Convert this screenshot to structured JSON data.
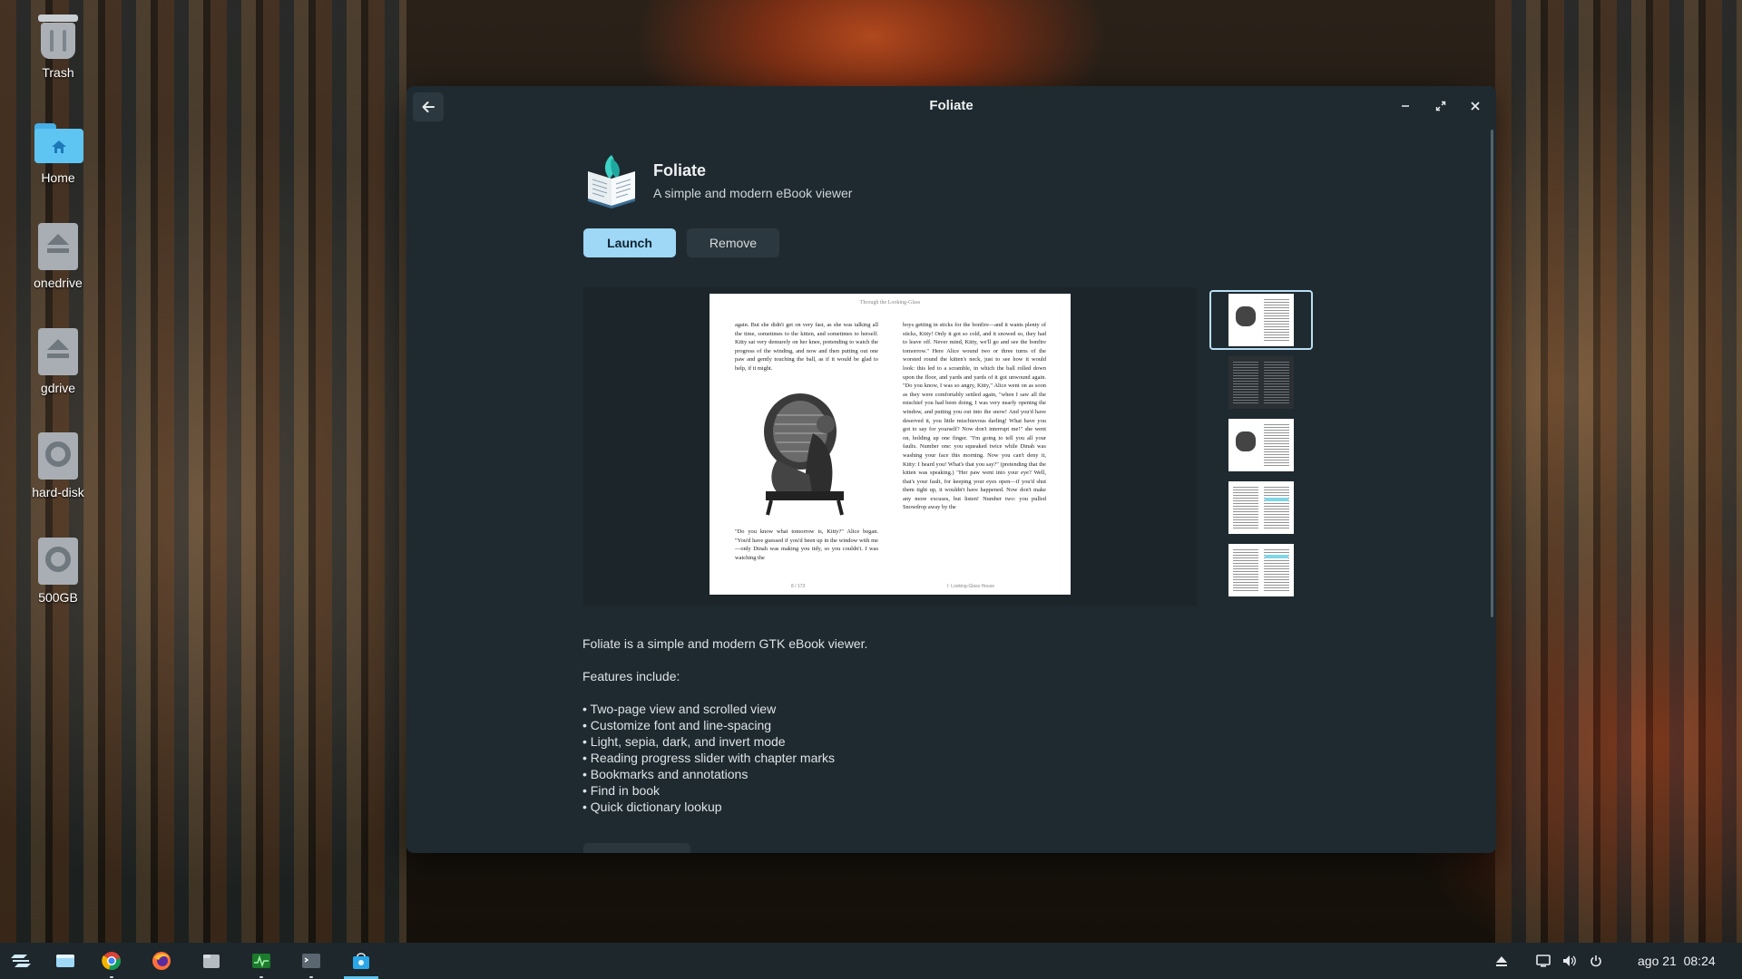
{
  "desktop": {
    "icons": [
      {
        "label": "Trash",
        "icon": "trash-icon"
      },
      {
        "label": "Home",
        "icon": "home-folder-icon"
      },
      {
        "label": "onedrive",
        "icon": "drive-eject-icon"
      },
      {
        "label": "gdrive",
        "icon": "drive-eject-icon"
      },
      {
        "label": "hard-disk",
        "icon": "hard-disk-icon"
      },
      {
        "label": "500GB",
        "icon": "hard-disk-icon"
      }
    ]
  },
  "window": {
    "title": "Foliate",
    "back_icon": "arrow-left-icon",
    "controls": [
      "minimize-icon",
      "maximize-icon",
      "close-icon"
    ]
  },
  "app": {
    "name": "Foliate",
    "summary": "A simple and modern eBook viewer",
    "icon": "book-with-leaf-icon",
    "launch_label": "Launch",
    "remove_label": "Remove",
    "accent": "#9fd8f6"
  },
  "screenshot": {
    "header": "Through the Looking-Glass",
    "left_top": "again. But she didn't get on very fast, as she was talking all the time, sometimes to the kitten, and sometimes to herself. Kitty sat very demurely on her knee, pretending to watch the progress of the winding, and now and then putting out one paw and gently touching the ball, as if it would be glad to help, if it might.",
    "left_bottom": "\"Do you know what tomorrow is, Kitty?\" Alice began. \"You'd have guessed if you'd been up in the window with me—only Dinah was making you tidy, so you couldn't. I was watching the",
    "right": "boys getting in sticks for the bonfire—and it wants plenty of sticks, Kitty! Only it got so cold, and it snowed so, they had to leave off. Never mind, Kitty, we'll go and see the bonfire tomorrow.\" Here Alice wound two or three turns of the worsted round the kitten's neck, just to see how it would look: this led to a scramble, in which the ball rolled down upon the floor, and yards and yards of it got unwound again. \"Do you know, I was so angry, Kitty,\" Alice went on as soon as they were comfortably settled again, \"when I saw all the mischief you had been doing, I was very nearly opening the window, and putting you out into the snow! And you'd have deserved it, you little mischievous darling! What have you got to say for yourself? Now don't interrupt me!\" she went on, holding up one finger. \"I'm going to tell you all your faults. Number one: you squeaked twice while Dinah was washing your face this morning. Now you can't deny it, Kitty: I heard you! What's that you say?\" (pretending that the kitten was speaking.) \"Her paw went into your eye? Well, that's your fault, for keeping your eyes open—if you'd shut them tight up, it wouldn't have happened. Now don't make any more excuses, but listen! Number two: you pulled Snowdrop away by the",
    "footer_left": "8 / 173",
    "footer_right": "I: Looking-Glass House",
    "thumbnail_count": 5,
    "selected_thumbnail": 1
  },
  "description": {
    "intro": "Foliate is a simple and modern GTK eBook viewer.",
    "features_heading": "Features include:",
    "features": [
      "• Two-page view and scrolled view",
      "• Customize font and line-spacing",
      "• Light, sepia, dark, and invert mode",
      "• Reading progress slider with chapter marks",
      "• Bookmarks and annotations",
      "• Find in book",
      "• Quick dictionary lookup"
    ]
  },
  "taskbar": {
    "items": [
      "zorin-menu-icon",
      "files-window-icon",
      "chrome-icon",
      "firefox-icon",
      "file-manager-icon",
      "system-monitor-icon",
      "terminal-icon",
      "software-store-icon"
    ],
    "tray": [
      "eject-icon",
      "screen-icon",
      "volume-icon",
      "power-icon"
    ],
    "date": "ago 21",
    "time": "08:24"
  }
}
